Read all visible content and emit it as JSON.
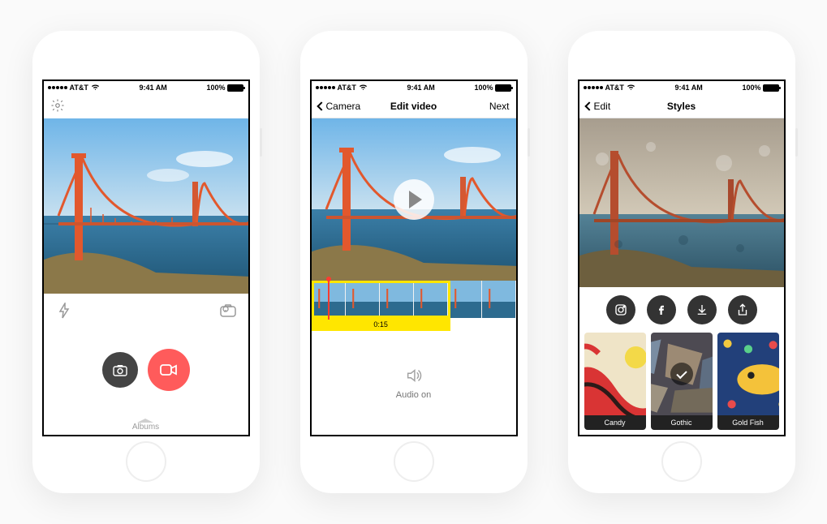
{
  "status": {
    "carrier": "AT&T",
    "time": "9:41 AM",
    "battery": "100%"
  },
  "screens": {
    "s1": {
      "albums": "Albums"
    },
    "s2": {
      "back": "Camera",
      "title": "Edit video",
      "next": "Next",
      "duration": "0:15",
      "audio": "Audio on"
    },
    "s3": {
      "back": "Edit",
      "title": "Styles",
      "styles": [
        {
          "label": "Candy"
        },
        {
          "label": "Gothic"
        },
        {
          "label": "Gold Fish"
        }
      ]
    }
  }
}
